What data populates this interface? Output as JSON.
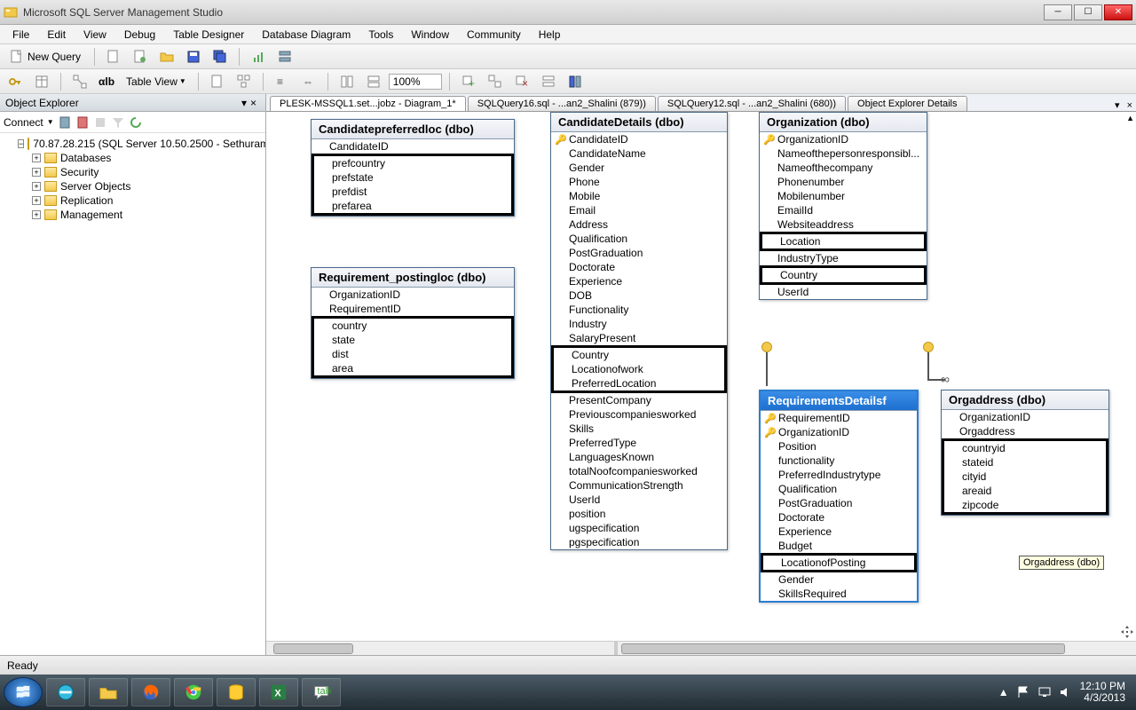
{
  "app": {
    "title": "Microsoft SQL Server Management Studio"
  },
  "menu": {
    "file": "File",
    "edit": "Edit",
    "view": "View",
    "debug": "Debug",
    "table_designer": "Table Designer",
    "database_diagram": "Database Diagram",
    "tools": "Tools",
    "window": "Window",
    "community": "Community",
    "help": "Help"
  },
  "toolbar": {
    "new_query": "New Query",
    "table_view": "Table View",
    "zoom": "100%"
  },
  "object_explorer": {
    "title": "Object Explorer",
    "connect": "Connect",
    "server": "70.87.28.215 (SQL Server 10.50.2500 - Sethuram",
    "nodes": [
      "Databases",
      "Security",
      "Server Objects",
      "Replication",
      "Management"
    ]
  },
  "tabs": {
    "t1": "PLESK-MSSQL1.set...jobz - Diagram_1*",
    "t2": "SQLQuery16.sql - ...an2_Shalini (879))",
    "t3": "SQLQuery12.sql - ...an2_Shalini (680))",
    "t4": "Object Explorer Details"
  },
  "tables": {
    "candidatepreferredloc": {
      "title": "Candidatepreferredloc (dbo)",
      "cols_plain": [
        "CandidateID"
      ],
      "cols_boxed": [
        "prefcountry",
        "prefstate",
        "prefdist",
        "prefarea"
      ]
    },
    "requirement_postingloc": {
      "title": "Requirement_postingloc (dbo)",
      "cols_plain": [
        "OrganizationID",
        "RequirementID"
      ],
      "cols_boxed": [
        "country",
        "state",
        "dist",
        "area"
      ]
    },
    "candidatedetails": {
      "title": "CandidateDetails (dbo)",
      "pk": [
        "CandidateID"
      ],
      "cols": [
        "CandidateName",
        "Gender",
        "Phone",
        "Mobile",
        "Email",
        "Address",
        "Qualification",
        "PostGraduation",
        "Doctorate",
        "Experience",
        "DOB",
        "Functionality",
        "Industry",
        "SalaryPresent"
      ],
      "cols_boxed": [
        "Country",
        "Locationofwork",
        "PreferredLocation"
      ],
      "cols2": [
        "PresentCompany",
        "Previouscompaniesworked",
        "Skills",
        "PreferredType",
        "LanguagesKnown",
        "totalNoofcompaniesworked",
        "CommunicationStrength",
        "UserId",
        "position",
        "ugspecification",
        "pgspecification"
      ]
    },
    "organization": {
      "title": "Organization (dbo)",
      "pk": [
        "OrganizationID"
      ],
      "cols": [
        "Nameofthepersonresponsibl...",
        "Nameofthecompany",
        "Phonenumber",
        "Mobilenumber",
        "EmailId",
        "Websiteaddress"
      ],
      "box1": "Location",
      "mid": [
        "IndustryType"
      ],
      "box2": "Country",
      "cols2": [
        "UserId"
      ]
    },
    "requirementsdetails": {
      "title": "RequirementsDetailsf",
      "pk": [
        "RequirementID",
        "OrganizationID"
      ],
      "cols": [
        "Position",
        "functionality",
        "PreferredIndustrytype",
        "Qualification",
        "PostGraduation",
        "Doctorate",
        "Experience",
        "Budget"
      ],
      "box": "LocationofPosting",
      "cols2": [
        "Gender",
        "SkillsRequired"
      ]
    },
    "orgaddress": {
      "title": "Orgaddress (dbo)",
      "cols_plain": [
        "OrganizationID",
        "Orgaddress"
      ],
      "cols_boxed": [
        "countryid",
        "stateid",
        "cityid",
        "areaid",
        "zipcode"
      ]
    }
  },
  "tooltip": "Orgaddress (dbo)",
  "status": "Ready",
  "clock": {
    "time": "12:10 PM",
    "date": "4/3/2013"
  }
}
